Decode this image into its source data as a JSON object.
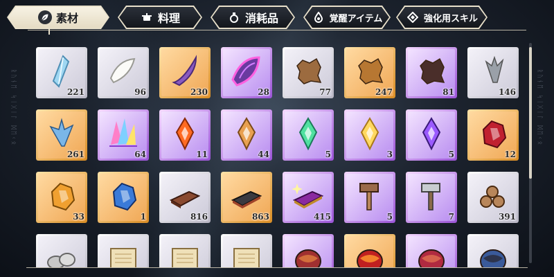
{
  "tabs": [
    {
      "label": "素材",
      "icon": "leaf-icon",
      "active": true
    },
    {
      "label": "料理",
      "icon": "pot-icon",
      "active": false
    },
    {
      "label": "消耗品",
      "icon": "flask-icon",
      "active": false
    },
    {
      "label": "覚醒アイテム",
      "icon": "awaken-drop-icon",
      "active": false
    },
    {
      "label": "強化用スキル",
      "icon": "skill-diamond-icon",
      "active": false
    }
  ],
  "side_decoration": "ᚱᚢᚾᛖ ᛋᛁᚷᛁᛚ ᛞᛖᚲᛟ",
  "items": [
    {
      "name": "blue-crystal",
      "rarity": "white",
      "qty": "221",
      "icon": "blue-crystal-icon"
    },
    {
      "name": "white-fang",
      "rarity": "white",
      "qty": "96",
      "icon": "white-fang-icon"
    },
    {
      "name": "purple-horn",
      "rarity": "orange",
      "qty": "230",
      "icon": "purple-horn-icon"
    },
    {
      "name": "magic-scale",
      "rarity": "purple",
      "qty": "28",
      "icon": "magic-scale-icon"
    },
    {
      "name": "small-hide",
      "rarity": "white",
      "qty": "77",
      "icon": "small-hide-icon"
    },
    {
      "name": "beast-hide",
      "rarity": "orange",
      "qty": "247",
      "icon": "beast-hide-icon"
    },
    {
      "name": "dark-hide",
      "rarity": "purple",
      "qty": "81",
      "icon": "dark-hide-icon"
    },
    {
      "name": "gray-feathers",
      "rarity": "white",
      "qty": "146",
      "icon": "gray-feather-icon"
    },
    {
      "name": "blue-feathers",
      "rarity": "orange",
      "qty": "261",
      "icon": "blue-feather-icon"
    },
    {
      "name": "rainbow-crystal",
      "rarity": "purple",
      "qty": "64",
      "icon": "rainbow-crystal-icon"
    },
    {
      "name": "fire-gem",
      "rarity": "purple",
      "qty": "11",
      "icon": "fire-gem-icon"
    },
    {
      "name": "earth-gem",
      "rarity": "purple",
      "qty": "44",
      "icon": "earth-gem-icon"
    },
    {
      "name": "wind-gem",
      "rarity": "purple",
      "qty": "5",
      "icon": "wind-gem-icon"
    },
    {
      "name": "light-gem",
      "rarity": "purple",
      "qty": "3",
      "icon": "light-gem-icon"
    },
    {
      "name": "dark-gem",
      "rarity": "purple",
      "qty": "5",
      "icon": "dark-gem-icon"
    },
    {
      "name": "red-ore",
      "rarity": "orange",
      "qty": "12",
      "icon": "red-ore-icon"
    },
    {
      "name": "gold-ore",
      "rarity": "orange",
      "qty": "33",
      "icon": "gold-ore-icon"
    },
    {
      "name": "blue-ore",
      "rarity": "orange",
      "qty": "1",
      "icon": "blue-ore-icon"
    },
    {
      "name": "whetstone",
      "rarity": "white",
      "qty": "816",
      "icon": "whetstone-icon"
    },
    {
      "name": "dark-whetstone",
      "rarity": "orange",
      "qty": "863",
      "icon": "dark-whetstone-icon"
    },
    {
      "name": "glowing-whetstone",
      "rarity": "purple",
      "qty": "415",
      "icon": "glowing-whetstone-icon"
    },
    {
      "name": "wood-hammer",
      "rarity": "purple",
      "qty": "5",
      "icon": "wood-hammer-icon"
    },
    {
      "name": "iron-hammer",
      "rarity": "purple",
      "qty": "7",
      "icon": "iron-hammer-icon"
    },
    {
      "name": "logs",
      "rarity": "white",
      "qty": "391",
      "icon": "logs-icon"
    },
    {
      "name": "stones",
      "rarity": "white",
      "qty": "",
      "icon": "stones-icon"
    },
    {
      "name": "scroll-a",
      "rarity": "white",
      "qty": "",
      "icon": "scroll-icon"
    },
    {
      "name": "scroll-b",
      "rarity": "white",
      "qty": "",
      "icon": "scroll-icon"
    },
    {
      "name": "scroll-c",
      "rarity": "white",
      "qty": "",
      "icon": "scroll-icon"
    },
    {
      "name": "red-cloth",
      "rarity": "purple",
      "qty": "",
      "icon": "red-cloth-icon"
    },
    {
      "name": "fire-cloth",
      "rarity": "orange",
      "qty": "",
      "icon": "fire-cloth-icon"
    },
    {
      "name": "crimson-cloth",
      "rarity": "purple",
      "qty": "",
      "icon": "crimson-cloth-icon"
    },
    {
      "name": "blue-cloth",
      "rarity": "white",
      "qty": "",
      "icon": "blue-cloth-icon"
    }
  ],
  "colors": {
    "tab_active_bg": "#f0ead8",
    "tab_bg": "#1b1f26",
    "white_rarity": "#d9d7e4",
    "orange_rarity": "#f2a24a",
    "purple_rarity": "#b57ef0"
  }
}
